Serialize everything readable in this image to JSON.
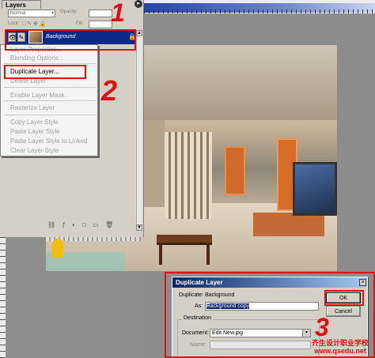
{
  "layers_panel": {
    "tab": "Layers",
    "blend_mode": "Normal",
    "opacity_label": "Opacity:",
    "lock_label": "Lock:",
    "fill_label": "Fill:",
    "layer_name": "Background"
  },
  "context_menu": {
    "items": [
      {
        "label": "Layer Properties...",
        "enabled": false
      },
      {
        "label": "Blending Options...",
        "enabled": false
      },
      {
        "label": "Duplicate Layer...",
        "enabled": true
      },
      {
        "label": "Delete Layer",
        "enabled": false
      },
      {
        "label": "Enable Layer Mask",
        "enabled": false
      },
      {
        "label": "Rasterize Layer",
        "enabled": false
      },
      {
        "label": "Copy Layer Style",
        "enabled": false
      },
      {
        "label": "Paste Layer Style",
        "enabled": false
      },
      {
        "label": "Paste Layer Style to Linked",
        "enabled": false
      },
      {
        "label": "Clear Layer Style",
        "enabled": false
      }
    ]
  },
  "annotations": {
    "step1": "1",
    "step2": "2",
    "step3": "3"
  },
  "dialog": {
    "title": "Duplicate Layer",
    "duplicate_label": "Duplicate: Background",
    "as_label": "As:",
    "as_value": "Background copy",
    "destination_label": "Destination",
    "document_label": "Document:",
    "document_value": "Edit New.jpg",
    "name_label": "Name:",
    "ok_label": "OK",
    "cancel_label": "Cancel"
  },
  "watermark": {
    "line1": "齐生设计职业学校",
    "line2": "www.qsedu.net"
  },
  "colors": {
    "annotation_red": "#e01010",
    "selection_blue": "#0a246a"
  }
}
